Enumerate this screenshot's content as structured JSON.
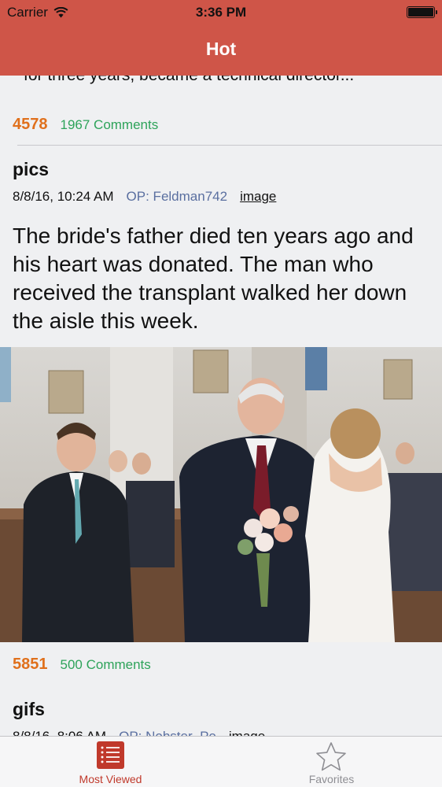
{
  "status_bar": {
    "carrier": "Carrier",
    "time": "3:36 PM"
  },
  "nav": {
    "title": "Hot"
  },
  "previous_post": {
    "excerpt": "for three years, became a technical director...",
    "score": "4578",
    "comments": "1967 Comments"
  },
  "post": {
    "category": "pics",
    "date": "8/8/16, 10:24 AM",
    "op": "OP: Feldman742",
    "type": "image",
    "title": "The bride's father died ten years ago and his heart was donated. The man who received the transplant walked her down the aisle this week.",
    "score": "5851",
    "comments": "500 Comments"
  },
  "next_post": {
    "category": "gifs",
    "date": "8/8/16, 8:06 AM",
    "op": "OP: Nobster_Po",
    "type": "image"
  },
  "tabbar": {
    "tabs": [
      {
        "label": "Most Viewed",
        "icon": "list-icon",
        "selected": true
      },
      {
        "label": "Favorites",
        "icon": "star-icon",
        "selected": false
      }
    ]
  },
  "colors": {
    "nav_background": "#cf5548",
    "score": "#e0701c",
    "comments": "#2ea35a",
    "op": "#5a6fa0",
    "tab_selected": "#c0392b",
    "tab_unselected": "#8e8e93"
  }
}
